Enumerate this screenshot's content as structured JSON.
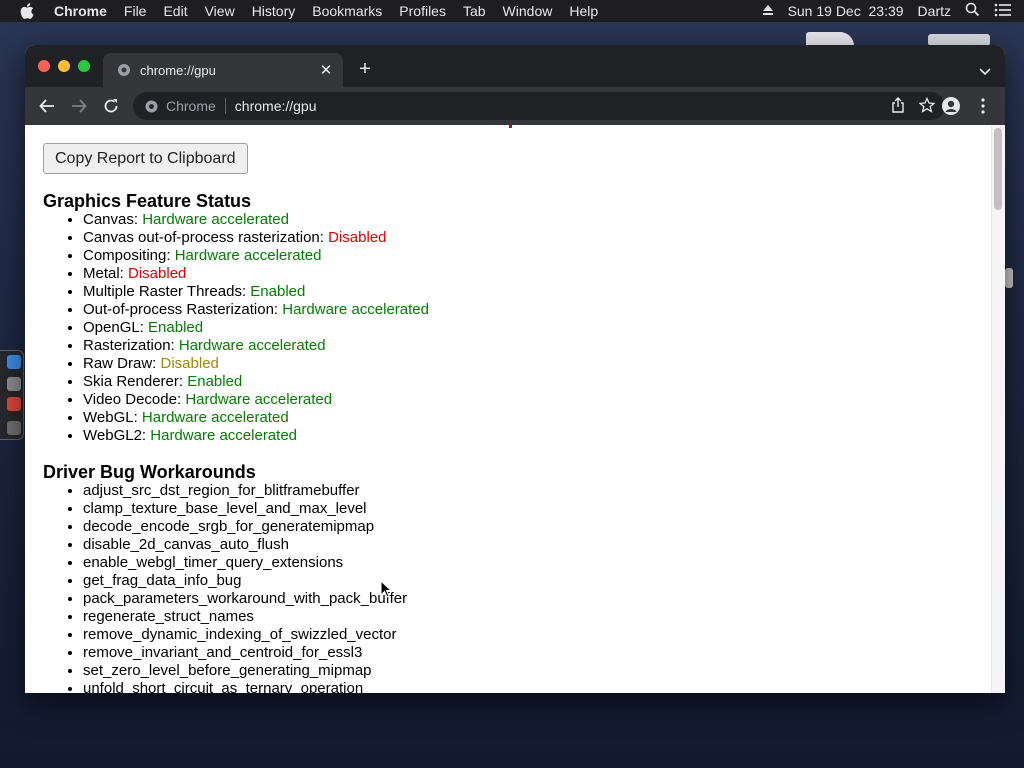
{
  "menubar": {
    "app_name": "Chrome",
    "items": [
      "File",
      "Edit",
      "View",
      "History",
      "Bookmarks",
      "Profiles",
      "Tab",
      "Window",
      "Help"
    ],
    "datetime": "Sun 19 Dec  23:39",
    "user": "Dartz",
    "icons": [
      "apple-icon",
      "eject-icon",
      "spotlight-icon",
      "control-center-icon"
    ]
  },
  "tab": {
    "title": "chrome://gpu",
    "favicon": "globe-icon"
  },
  "omnibox": {
    "scheme_label": "Chrome",
    "url": "chrome://gpu"
  },
  "page": {
    "copy_button": "Copy Report to Clipboard",
    "feature_status_heading": "Graphics Feature Status",
    "features": [
      {
        "name": "Canvas: ",
        "status": "Hardware accelerated",
        "color": "#008000"
      },
      {
        "name": "Canvas out-of-process rasterization: ",
        "status": "Disabled",
        "color": "#e00000"
      },
      {
        "name": "Compositing: ",
        "status": "Hardware accelerated",
        "color": "#008000"
      },
      {
        "name": "Metal: ",
        "status": "Disabled",
        "color": "#e00000"
      },
      {
        "name": "Multiple Raster Threads: ",
        "status": "Enabled",
        "color": "#008000"
      },
      {
        "name": "Out-of-process Rasterization: ",
        "status": "Hardware accelerated",
        "color": "#008000"
      },
      {
        "name": "OpenGL: ",
        "status": "Enabled",
        "color": "#008000"
      },
      {
        "name": "Rasterization: ",
        "status": "Hardware accelerated",
        "color": "#008000"
      },
      {
        "name": "Raw Draw: ",
        "status": "Disabled",
        "color": "#a08800"
      },
      {
        "name": "Skia Renderer: ",
        "status": "Enabled",
        "color": "#008000"
      },
      {
        "name": "Video Decode: ",
        "status": "Hardware accelerated",
        "color": "#008000"
      },
      {
        "name": "WebGL: ",
        "status": "Hardware accelerated",
        "color": "#008000"
      },
      {
        "name": "WebGL2: ",
        "status": "Hardware accelerated",
        "color": "#008000"
      }
    ],
    "workarounds_heading": "Driver Bug Workarounds",
    "workarounds": [
      "adjust_src_dst_region_for_blitframebuffer",
      "clamp_texture_base_level_and_max_level",
      "decode_encode_srgb_for_generatemipmap",
      "disable_2d_canvas_auto_flush",
      "enable_webgl_timer_query_extensions",
      "get_frag_data_info_bug",
      "pack_parameters_workaround_with_pack_buffer",
      "regenerate_struct_names",
      "remove_dynamic_indexing_of_swizzled_vector",
      "remove_invariant_and_centroid_for_essl3",
      "set_zero_level_before_generating_mipmap",
      "unfold_short_circuit_as_ternary_operation"
    ]
  }
}
